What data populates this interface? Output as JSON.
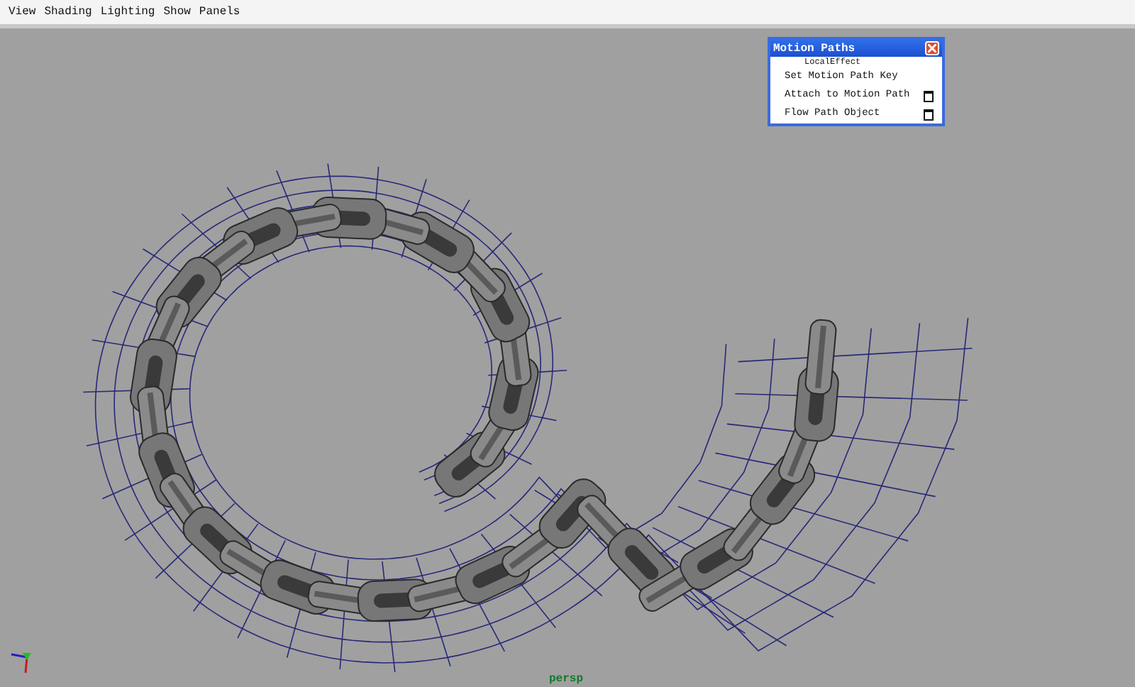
{
  "menu_bar": {
    "items": [
      "View",
      "Shading",
      "Lighting",
      "Show",
      "Panels"
    ]
  },
  "motion_paths_panel": {
    "title": "Motion Paths",
    "items": [
      {
        "label": "LocalEffect",
        "kind": "cut",
        "option_box": false
      },
      {
        "label": "Set Motion Path Key",
        "kind": "item",
        "option_box": false
      },
      {
        "label": "Attach to Motion Path",
        "kind": "item",
        "option_box": true
      },
      {
        "label": "Flow Path Object",
        "kind": "item",
        "option_box": true
      }
    ]
  },
  "viewport": {
    "camera_label": "persp"
  }
}
